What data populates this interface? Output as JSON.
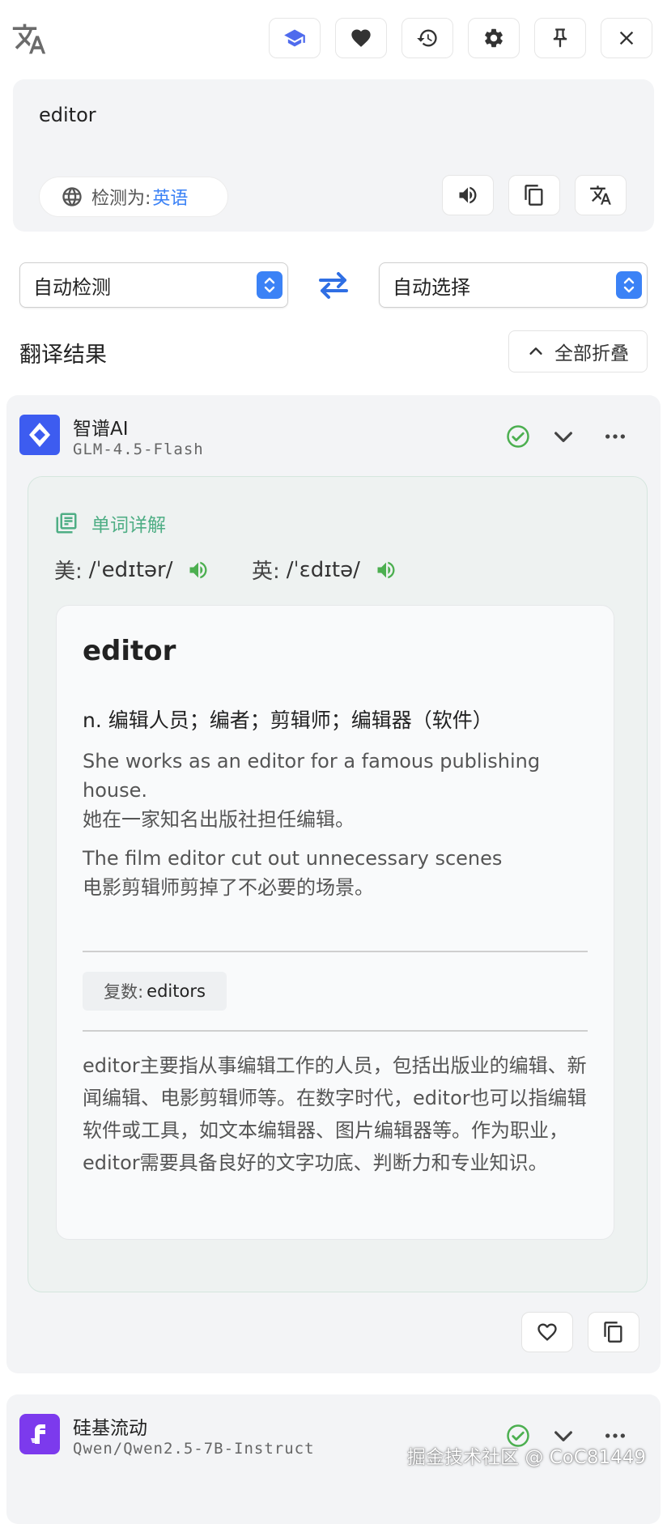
{
  "toolbar": {
    "buttons": [
      "learn-icon",
      "favorite-icon",
      "history-icon",
      "settings-icon",
      "pin-icon",
      "close-icon"
    ]
  },
  "input": {
    "text": "editor",
    "detect_label": "检测为:",
    "detect_value": "英语"
  },
  "languages": {
    "source": "自动检测",
    "target": "自动选择"
  },
  "results": {
    "title": "翻译结果",
    "collapse_all": "全部折叠"
  },
  "service1": {
    "name": "智谱AI",
    "model": "GLM-4.5-Flash",
    "status": "success",
    "section_label": "单词详解",
    "phonetics": {
      "us_label": "美:",
      "us": "/ˈedɪtər/",
      "uk_label": "英:",
      "uk": "/ˈɛdɪtə/"
    },
    "word": "editor",
    "definition": "n. 编辑人员；编者；剪辑师；编辑器（软件）",
    "examples": [
      {
        "en": "She works as an editor for a famous publishing house.",
        "zh": "她在一家知名出版社担任编辑。"
      },
      {
        "en": "The film editor cut out unnecessary scenes",
        "zh": "电影剪辑师剪掉了不必要的场景。"
      }
    ],
    "plural_label": "复数:",
    "plural_value": "editors",
    "description": "editor主要指从事编辑工作的人员，包括出版业的编辑、新闻编辑、电影剪辑师等。在数字时代，editor也可以指编辑软件或工具，如文本编辑器、图片编辑器等。作为职业，editor需要具备良好的文字功底、判断力和专业知识。"
  },
  "service2": {
    "name": "硅基流动",
    "model": "Qwen/Qwen2.5-7B-Instruct",
    "status": "success"
  },
  "watermark": "掘金技术社区 @ CoC81449",
  "colors": {
    "accent": "#3b82f6",
    "success": "#4caf50",
    "word_section": "#4fae85"
  }
}
